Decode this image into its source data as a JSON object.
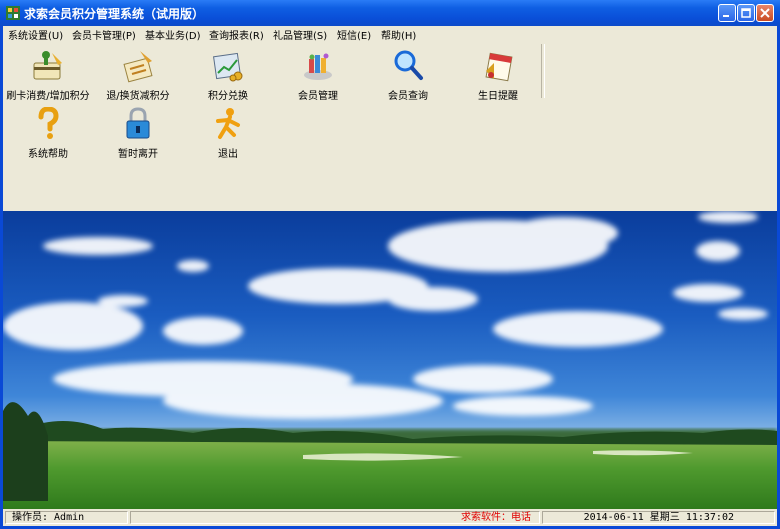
{
  "window": {
    "title": "求索会员积分管理系统（试用版）"
  },
  "menu": [
    {
      "label": "系统设置(U)"
    },
    {
      "label": "会员卡管理(P)"
    },
    {
      "label": "基本业务(D)"
    },
    {
      "label": "查询报表(R)"
    },
    {
      "label": "礼品管理(S)"
    },
    {
      "label": "短信(E)"
    },
    {
      "label": "帮助(H)"
    }
  ],
  "toolbar": {
    "row1": [
      {
        "label": "刷卡消费/增加积分",
        "icon": "card-swipe-add-points-icon"
      },
      {
        "label": "退/换货减积分",
        "icon": "return-deduct-points-icon"
      },
      {
        "label": "积分兑换",
        "icon": "points-exchange-icon"
      },
      {
        "label": "会员管理",
        "icon": "member-management-icon"
      },
      {
        "label": "会员查询",
        "icon": "magnifier-search-icon"
      },
      {
        "label": "生日提醒",
        "icon": "birthday-calendar-icon"
      }
    ],
    "row2": [
      {
        "label": "系统帮助",
        "icon": "question-mark-help-icon"
      },
      {
        "label": "暂时离开",
        "icon": "padlock-icon"
      },
      {
        "label": "退出",
        "icon": "running-person-exit-icon"
      }
    ]
  },
  "status": {
    "operator": "操作员: Admin",
    "vendor": "求索软件：电话",
    "datetime": "2014-06-11 星期三 11:37:02"
  },
  "colors": {
    "titlebar": "#0a4fd8",
    "chrome": "#ece9d8",
    "vendor_text": "#e00000",
    "sky": "#1a5cc0",
    "grass": "#3f8f2a"
  }
}
